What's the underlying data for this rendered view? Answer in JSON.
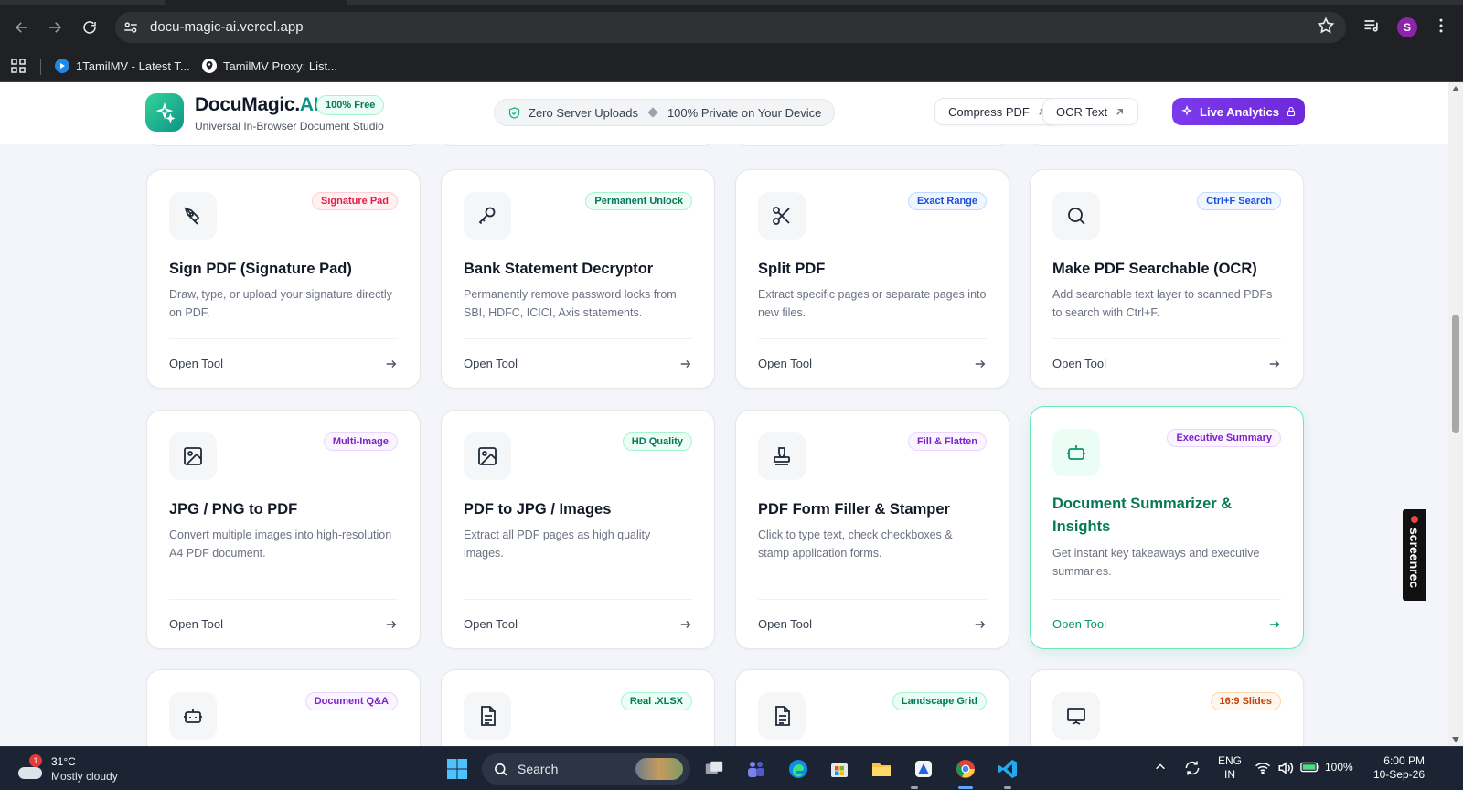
{
  "browser": {
    "url": "docu-magic-ai.vercel.app",
    "profile_initial": "S",
    "bookmarks": [
      {
        "label": "1TamilMV - Latest T..."
      },
      {
        "label": "TamilMV Proxy: List..."
      }
    ]
  },
  "header": {
    "brand_main": "DocuMagic.",
    "brand_accent": "AI",
    "free_badge": "100% Free",
    "subtitle": "Universal In-Browser Document Studio",
    "privacy": {
      "left": "Zero Server Uploads",
      "right": "100% Private on Your Device"
    },
    "buttons": {
      "compress": "Compress PDF",
      "ocr": "OCR Text",
      "analytics": "Live Analytics"
    }
  },
  "cards": [
    {
      "title": "Sign PDF (Signature Pad)",
      "tag": "Signature Pad",
      "desc": "Draw, type, or upload your signature directly on PDF.",
      "action": "Open Tool",
      "icon": "pen-tool-icon",
      "tag_color": "#e11d48"
    },
    {
      "title": "Bank Statement Decryptor",
      "tag": "Permanent Unlock",
      "desc": "Permanently remove password locks from SBI, HDFC, ICICI, Axis statements.",
      "action": "Open Tool",
      "icon": "key-icon",
      "tag_color": "#047857"
    },
    {
      "title": "Split PDF",
      "tag": "Exact Range",
      "desc": "Extract specific pages or separate pages into new files.",
      "action": "Open Tool",
      "icon": "scissors-icon",
      "tag_color": "#1d4ed8"
    },
    {
      "title": "Make PDF Searchable (OCR)",
      "tag": "Ctrl+F Search",
      "desc": "Add searchable text layer to scanned PDFs to search with Ctrl+F.",
      "action": "Open Tool",
      "icon": "search-icon",
      "tag_color": "#1d4ed8"
    },
    {
      "title": "JPG / PNG to PDF",
      "tag": "Multi-Image",
      "desc": "Convert multiple images into high-resolution A4 PDF document.",
      "action": "Open Tool",
      "icon": "image-icon",
      "tag_color": "#7e22ce"
    },
    {
      "title": "PDF to JPG / Images",
      "tag": "HD Quality",
      "desc": "Extract all PDF pages as high quality images.",
      "action": "Open Tool",
      "icon": "image-icon",
      "tag_color": "#047857"
    },
    {
      "title": "PDF Form Filler & Stamper",
      "tag": "Fill & Flatten",
      "desc": "Click to type text, check checkboxes & stamp application forms.",
      "action": "Open Tool",
      "icon": "stamp-icon",
      "tag_color": "#7e22ce"
    },
    {
      "title": "Document Summarizer & Insights",
      "tag": "Executive Summary",
      "desc": "Get instant key takeaways and executive summaries.",
      "action": "Open Tool",
      "icon": "bot-icon",
      "tag_color": "#7e22ce"
    },
    {
      "title": "",
      "tag": "Document Q&A",
      "icon": "bot-icon",
      "tag_color": "#7e22ce"
    },
    {
      "title": "",
      "tag": "Real .XLSX",
      "icon": "file-spreadsheet-icon",
      "tag_color": "#047857"
    },
    {
      "title": "",
      "tag": "Landscape Grid",
      "icon": "file-text-icon",
      "tag_color": "#047857"
    },
    {
      "title": "",
      "tag": "16:9 Slides",
      "icon": "presentation-icon",
      "tag_color": "#c2410c"
    }
  ],
  "screenrec_label": "screenrec",
  "taskbar": {
    "weather": {
      "temp": "31°C",
      "desc": "Mostly cloudy",
      "alert": "1"
    },
    "search_label": "Search",
    "lang": "ENG",
    "region": "IN",
    "battery": "100%",
    "time": "6:00 PM",
    "date": "10-Sep-26"
  }
}
